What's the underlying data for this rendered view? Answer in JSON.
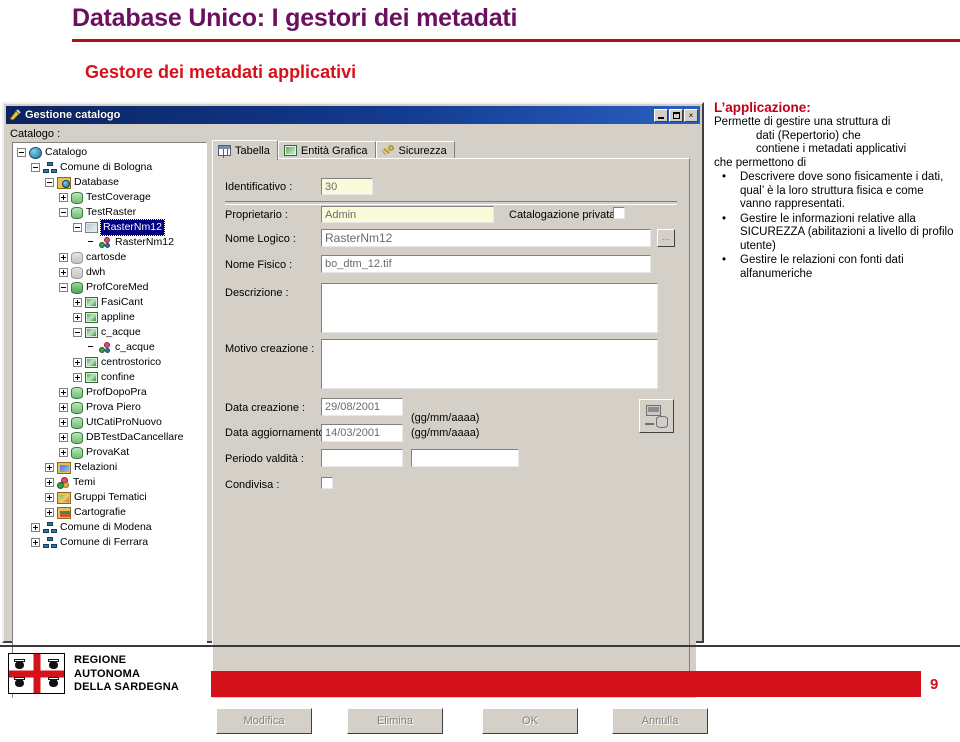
{
  "slide": {
    "title": "Database Unico: I gestori dei metadati",
    "subtitle": "Gestore dei metadati applicativi",
    "page_number": "9",
    "accent_purple": "#6b1060",
    "accent_red": "#d7111a",
    "rule_red": "#b11016"
  },
  "dialog": {
    "titlebar": {
      "title": "Gestione catalogo",
      "icon": "app-icon",
      "minimize_label": "_",
      "maximize_label": "□",
      "close_label": "×"
    },
    "catalog_label": "Catalogo :",
    "tree": [
      {
        "label": "Catalogo",
        "depth": 0,
        "expander": "minus",
        "icon": "globe-icon",
        "selected": false
      },
      {
        "label": "Comune di Bologna",
        "depth": 1,
        "expander": "minus",
        "icon": "network-icon",
        "selected": false
      },
      {
        "label": "Database",
        "depth": 2,
        "expander": "minus",
        "icon": "folder-globe-icon",
        "selected": false
      },
      {
        "label": "TestCoverage",
        "depth": 3,
        "expander": "plus",
        "icon": "database-icon",
        "selected": false
      },
      {
        "label": "TestRaster",
        "depth": 3,
        "expander": "minus",
        "icon": "database-icon",
        "selected": false
      },
      {
        "label": "RasterNm12",
        "depth": 4,
        "expander": "minus",
        "icon": "raster-gray-icon",
        "selected": true
      },
      {
        "label": "RasterNm12",
        "depth": 5,
        "expander": "none",
        "icon": "layer-dots-icon",
        "selected": false
      },
      {
        "label": "cartosde",
        "depth": 3,
        "expander": "plus",
        "icon": "database-dim-icon",
        "selected": false
      },
      {
        "label": "dwh",
        "depth": 3,
        "expander": "plus",
        "icon": "database-dim-icon",
        "selected": false
      },
      {
        "label": "ProfCoreMed",
        "depth": 3,
        "expander": "minus",
        "icon": "database-dark-icon",
        "selected": false
      },
      {
        "label": "FasiCant",
        "depth": 4,
        "expander": "plus",
        "icon": "raster-icon",
        "selected": false
      },
      {
        "label": "appline",
        "depth": 4,
        "expander": "plus",
        "icon": "raster-icon",
        "selected": false
      },
      {
        "label": "c_acque",
        "depth": 4,
        "expander": "minus",
        "icon": "raster-icon",
        "selected": false
      },
      {
        "label": "c_acque",
        "depth": 5,
        "expander": "none",
        "icon": "layer-dots-icon",
        "selected": false
      },
      {
        "label": "centrostorico",
        "depth": 4,
        "expander": "plus",
        "icon": "raster-icon",
        "selected": false
      },
      {
        "label": "confine",
        "depth": 4,
        "expander": "plus",
        "icon": "raster-icon",
        "selected": false
      },
      {
        "label": "ProfDopoPra",
        "depth": 3,
        "expander": "plus",
        "icon": "database-icon",
        "selected": false
      },
      {
        "label": "Prova Piero",
        "depth": 3,
        "expander": "plus",
        "icon": "database-icon",
        "selected": false
      },
      {
        "label": "UtCatiProNuovo",
        "depth": 3,
        "expander": "plus",
        "icon": "database-icon",
        "selected": false
      },
      {
        "label": "DBTestDaCancellare",
        "depth": 3,
        "expander": "plus",
        "icon": "database-icon",
        "selected": false
      },
      {
        "label": "ProvaKat",
        "depth": 3,
        "expander": "plus",
        "icon": "database-icon",
        "selected": false
      },
      {
        "label": "Relazioni",
        "depth": 2,
        "expander": "plus",
        "icon": "relations-icon",
        "selected": false
      },
      {
        "label": "Temi",
        "depth": 2,
        "expander": "plus",
        "icon": "themes-icon",
        "selected": false
      },
      {
        "label": "Gruppi Tematici",
        "depth": 2,
        "expander": "plus",
        "icon": "theme-groups-icon",
        "selected": false
      },
      {
        "label": "Cartografie",
        "depth": 2,
        "expander": "plus",
        "icon": "maps-icon",
        "selected": false
      },
      {
        "label": "Comune di Modena",
        "depth": 1,
        "expander": "plus",
        "icon": "network-icon",
        "selected": false
      },
      {
        "label": "Comune di Ferrara",
        "depth": 1,
        "expander": "plus",
        "icon": "network-icon",
        "selected": false
      }
    ],
    "tabs": [
      {
        "label": "Tabella",
        "icon": "table-grid-icon",
        "active": true
      },
      {
        "label": "Entità Grafica",
        "icon": "graphic-entity-icon",
        "active": false
      },
      {
        "label": "Sicurezza",
        "icon": "key-icon",
        "active": false
      }
    ],
    "form": {
      "identificativo_label": "Identificativo :",
      "identificativo_value": "30",
      "proprietario_label": "Proprietario :",
      "proprietario_value": "Admin",
      "catalogazione_label": "Catalogazione privata :",
      "nome_logico_label": "Nome Logico :",
      "nome_logico_value": "RasterNm12",
      "browse_label": "...",
      "nome_fisico_label": "Nome Fisico :",
      "nome_fisico_value": "bo_dtm_12.tif",
      "descrizione_label": "Descrizione :",
      "descrizione_value": "",
      "motivo_label": "Motivo creazione :",
      "motivo_value": "",
      "data_creazione_label": "Data creazione :",
      "data_creazione_value": "29/08/2001",
      "data_creazione_hint": "(gg/mm/aaaa)",
      "data_aggiornamento_label": "Data aggiornamento :",
      "data_aggiornamento_value": "14/03/2001",
      "data_aggiornamento_hint": "(gg/mm/aaaa)",
      "periodo_label": "Periodo valdità :",
      "periodo_from_value": "",
      "periodo_to_value": "",
      "condivisa_label": "Condivisa :",
      "db_button_icon": "monitor-database-icon"
    },
    "buttons": [
      {
        "label": "Modifica",
        "disabled": true
      },
      {
        "label": "Elimina",
        "disabled": true
      },
      {
        "label": "OK",
        "disabled": true
      },
      {
        "label": "Annulla",
        "disabled": true
      }
    ]
  },
  "text_column": {
    "heading": "L’applicazione:",
    "intro_line1": "Permette di gestire una struttura di",
    "intro_line2": "dati (Repertorio) che",
    "intro_line3": "contiene i metadati applicativi",
    "intro_line4": "che permettono di",
    "bullets": [
      "Descrivere dove sono fisicamente i dati, qual’ è la loro struttura fisica e come vanno rappresentati.",
      "Gestire le informazioni relative alla SICUREZZA (abilitazioni a livello di profilo utente)",
      "Gestire le relazioni con fonti dati alfanumeriche"
    ],
    "bullet_glyph": "•"
  },
  "footer": {
    "line1": "REGIONE",
    "line2": "AUTONOMA",
    "line3": "DELLA SARDEGNA",
    "flag_name": "sardinia-flag-icon",
    "bar_color": "#d4111b"
  }
}
